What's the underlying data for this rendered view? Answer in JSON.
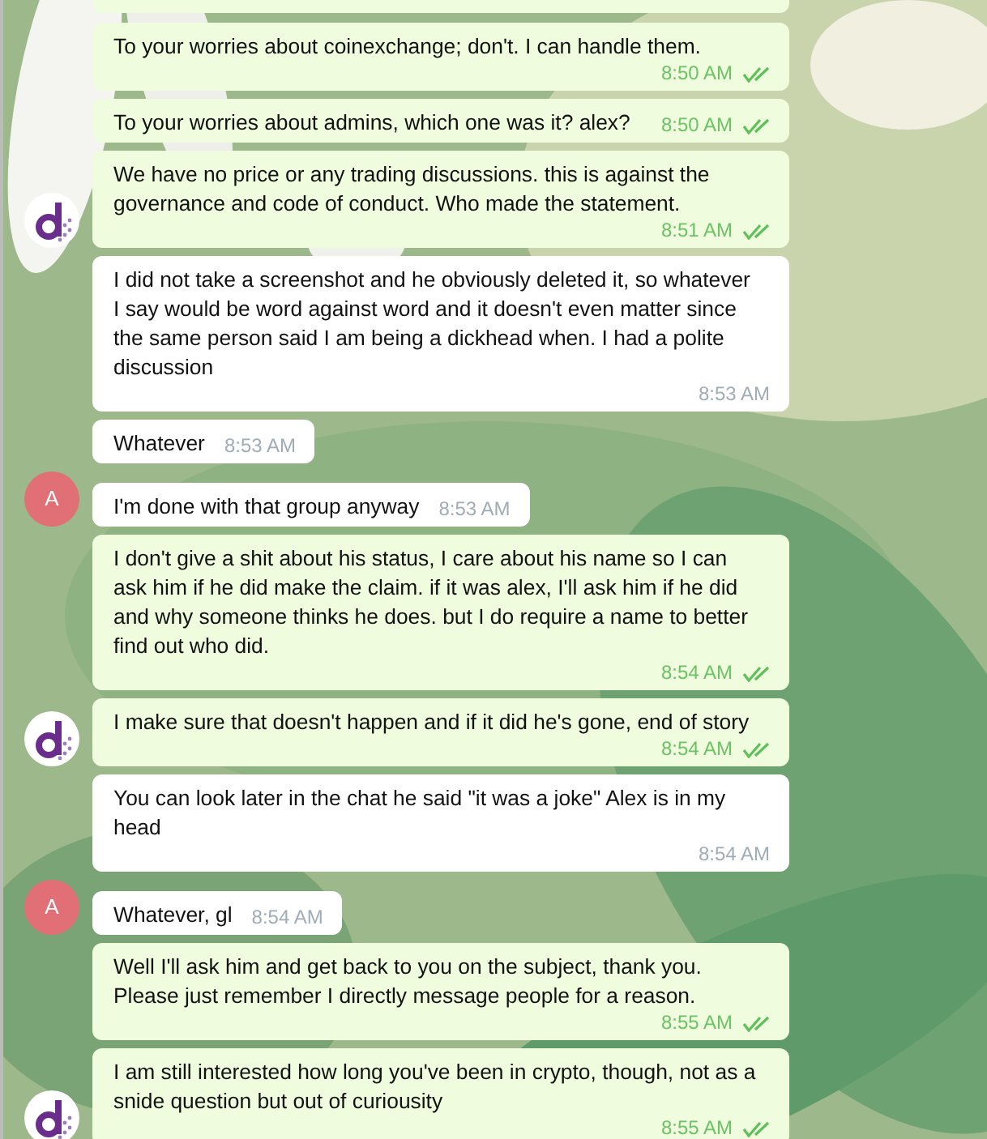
{
  "messages": [
    {
      "kind": "outgoing",
      "text": "To your worries about coinexchange; don't. I can handle them.",
      "time": "8:50 AM",
      "read": true
    },
    {
      "kind": "outgoing",
      "text": "To your worries about admins, which one was it? alex?",
      "time": "8:50 AM",
      "read": true
    },
    {
      "kind": "outgoing",
      "text": "We have no price or any trading discussions. this is against the governance and code of conduct. Who made the statement.",
      "time": "8:51 AM",
      "read": true,
      "avatar": {
        "kind": "logo"
      }
    },
    {
      "kind": "incoming",
      "text": "I did not take a screenshot and he obviously deleted it, so whatever I say would be word against word and it doesn't even matter since the same person said I am being a dickhead when. I had a polite discussion",
      "time": "8:53 AM"
    },
    {
      "kind": "incoming",
      "text": "Whatever",
      "time": "8:53 AM"
    },
    {
      "kind": "incoming",
      "text": "I'm done with that group anyway",
      "time": "8:53 AM",
      "avatar": {
        "kind": "letter",
        "letter": "A",
        "color": "#e17076"
      }
    },
    {
      "kind": "outgoing",
      "text": "I don't give a shit about his status, I care about his name so I can ask him if he did make the claim. if it was alex, I'll ask him if he did and why someone thinks he does. but I do require a name to better find out who did.",
      "time": "8:54 AM",
      "read": true
    },
    {
      "kind": "outgoing",
      "text": "I make sure that doesn't happen and if it did he's gone, end of story",
      "time": "8:54 AM",
      "read": true,
      "avatar": {
        "kind": "logo"
      }
    },
    {
      "kind": "incoming",
      "text": "You can look later in the chat he said \"it was a joke\" Alex is in my head",
      "time": "8:54 AM"
    },
    {
      "kind": "incoming",
      "text": "Whatever, gl",
      "time": "8:54 AM",
      "avatar": {
        "kind": "letter",
        "letter": "A",
        "color": "#e17076"
      }
    },
    {
      "kind": "outgoing",
      "text": "Well I'll ask him and get back to you on the subject, thank you. Please just remember I directly message people for a reason.",
      "time": "8:55 AM",
      "read": true
    },
    {
      "kind": "outgoing",
      "text": "I am still interested how long you've been in crypto, though, not as a snide question but out of curiousity",
      "time": "8:55 AM",
      "read": true,
      "avatar": {
        "kind": "logo"
      }
    }
  ]
}
